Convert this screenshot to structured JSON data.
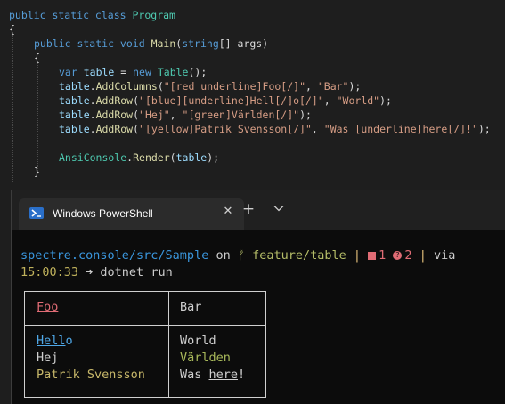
{
  "editor": {
    "line1": {
      "kw": "public static class",
      "cls": "Program"
    },
    "line2": "{",
    "line3": {
      "kw": "public static void",
      "fn": "Main",
      "p1": "(",
      "ptype": "string",
      "p2": "[] args)"
    },
    "line4": "{",
    "line5": {
      "kw1": "var",
      "var": "table",
      "eq": " = ",
      "kw2": "new",
      "cls": "Table",
      "end": "();"
    },
    "line6": {
      "obj": "table",
      "dot": ".",
      "fn": "AddColumns",
      "p1": "(",
      "s1": "\"[red underline]Foo[/]\"",
      "sep": ", ",
      "s2": "\"Bar\"",
      "end": ");"
    },
    "line7": {
      "obj": "table",
      "dot": ".",
      "fn": "AddRow",
      "p1": "(",
      "s1": "\"[blue][underline]Hell[/]o[/]\"",
      "sep": ", ",
      "s2": "\"World\"",
      "end": ");"
    },
    "line8": {
      "obj": "table",
      "dot": ".",
      "fn": "AddRow",
      "p1": "(",
      "s1": "\"Hej\"",
      "sep": ", ",
      "s2": "\"[green]Världen[/]\"",
      "end": ");"
    },
    "line9": {
      "obj": "table",
      "dot": ".",
      "fn": "AddRow",
      "p1": "(",
      "s1": "\"[yellow]Patrik Svensson[/]\"",
      "sep": ", ",
      "s2": "\"Was [underline]here[/]!\"",
      "end": ");"
    },
    "line10": {
      "cls": "AnsiConsole",
      "dot": ".",
      "fn": "Render",
      "p1": "(",
      "arg": "table",
      "end": ");"
    },
    "line11": "}"
  },
  "terminal": {
    "tab_title": "Windows PowerShell",
    "tab_close": "✕",
    "new_tab": "+",
    "dropdown": "⌵",
    "prompt": {
      "path": "spectre.console/src/Sample",
      "on": " on ",
      "branch_icon": "ᚠ",
      "branch": " feature/table",
      "sep1": " | ",
      "errors": "1",
      "warnings": "2",
      "sep2": " | ",
      "tail": "via"
    },
    "time": "15:00:33",
    "arrow": " ➜ ",
    "command": "dotnet run",
    "table": {
      "header": [
        "Foo",
        "Bar"
      ],
      "rows": [
        [
          "Hello",
          "World"
        ],
        [
          "Hej",
          "Världen"
        ],
        [
          "Patrik Svensson",
          "Was here!"
        ]
      ],
      "hello_ul": "Hell",
      "hello_rest": "o",
      "was": "Was ",
      "here": "here",
      "bang": "!"
    },
    "colors": {
      "background": "#0c0c0c",
      "path": "#3a96dd",
      "branch": "#b5bd68",
      "error": "#e06c75"
    }
  }
}
